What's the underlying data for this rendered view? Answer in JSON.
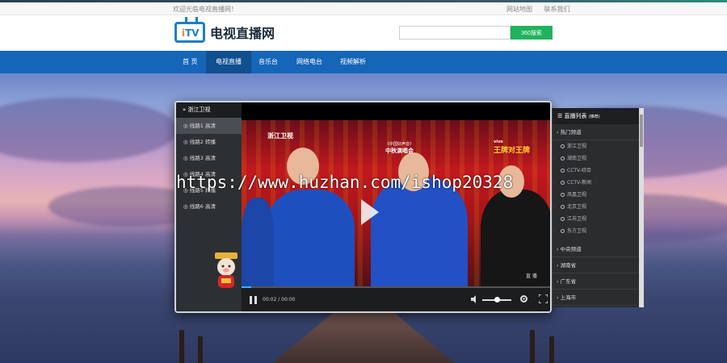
{
  "topbar": {
    "welcome": "欢迎光临电视直播网！",
    "links": [
      "网站地图",
      "联系我们"
    ]
  },
  "logo": {
    "text": "电视直播网",
    "mark_letters": "TV",
    "mark_number": "i"
  },
  "search": {
    "placeholder": "",
    "button": "360搜索"
  },
  "nav": [
    {
      "label": "首 页"
    },
    {
      "label": "电视直播"
    },
    {
      "label": "音乐台"
    },
    {
      "label": "网络电台"
    },
    {
      "label": "视频解析"
    }
  ],
  "player": {
    "current_channel": "浙江卫视",
    "channels": [
      "线路1 高清",
      "线路2 转播",
      "线路3 高清",
      "线路4 高清",
      "线路5 转播",
      "线路6 高清"
    ],
    "video": {
      "station_logo": "浙江卫视",
      "show_title": "中秋演唱会",
      "show_subtitle": "《中国好声音》",
      "corner_title": "王牌对王牌",
      "corner_brand": "vivo",
      "player_caption": "直 播"
    },
    "time_current": "00:02",
    "time_separator": "/",
    "time_total": "00:00",
    "progress": 0.03,
    "volume": 0.5
  },
  "list": {
    "title": "直播列表",
    "title_note": "(推荐)",
    "groups": [
      {
        "label": "热门频道",
        "items": [
          "浙江卫视",
          "湖南卫视",
          "CCTV-综合",
          "CCTV-新闻",
          "凤凰卫视",
          "北京卫视",
          "江苏卫视",
          "东方卫视"
        ]
      },
      {
        "label": "中央频道",
        "items": []
      },
      {
        "label": "湖南省",
        "items": []
      },
      {
        "label": "广东省",
        "items": []
      },
      {
        "label": "上海市",
        "items": []
      }
    ]
  },
  "watermark": "https://www.huzhan.com/ishop20328",
  "colors": {
    "nav": "#1565b8",
    "nav_active": "#104f90",
    "search_button": "#1fb35c",
    "logo": "#1d7fc6"
  }
}
